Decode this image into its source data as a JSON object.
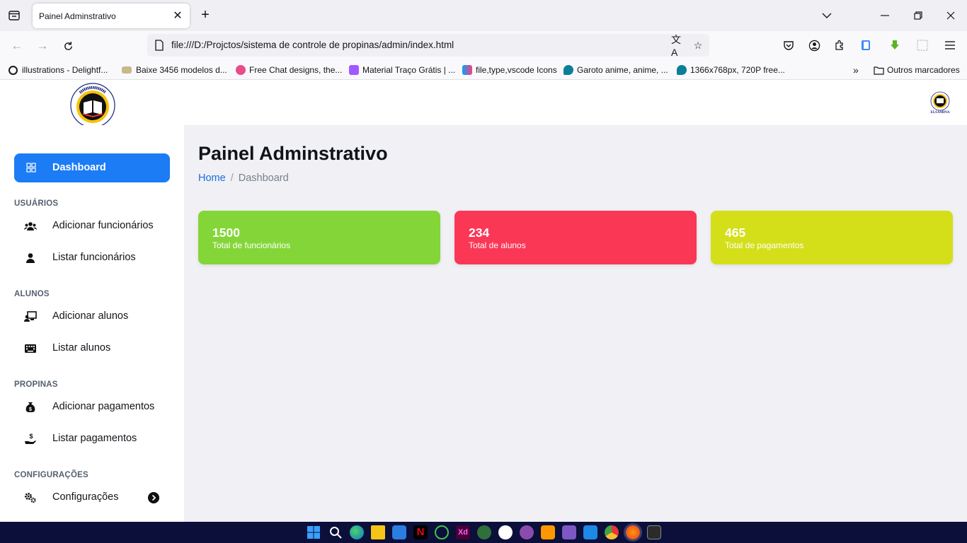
{
  "browser": {
    "tab_title": "Painel Adminstrativo",
    "new_tab": "+",
    "url": "file:///D:/Projctos/sistema de controle de propinas/admin/index.html",
    "bookmarks": [
      {
        "label": "illustrations - Delightf...",
        "color": "#1a1a1a"
      },
      {
        "label": "Baixe 3456 modelos d...",
        "color": "#c8b88a"
      },
      {
        "label": "Free Chat designs, the...",
        "color": "#ea4c89"
      },
      {
        "label": "Material Traço Grátis | ...",
        "color": "#a259ff"
      },
      {
        "label": "file,type,vscode Icons",
        "color": "#00a3ff"
      },
      {
        "label": "Garoto anime, anime, ...",
        "color": "#0a7f9a"
      },
      {
        "label": "1366x768px, 720P free...",
        "color": "#0a7f9a"
      }
    ],
    "other_bookmarks": "Outros marcadores"
  },
  "header": {
    "logo_alt": "ELSAMINA",
    "logo_ring_text": "INSTITUTO POLITÉCNICO PRIVADO"
  },
  "sidebar": {
    "active_item": "Dashboard",
    "sections": [
      {
        "heading": "USUÁRIOS",
        "items": [
          "Adicionar funcionários",
          "Listar funcionários"
        ]
      },
      {
        "heading": "ALUNOS",
        "items": [
          "Adicionar alunos",
          "Listar alunos"
        ]
      },
      {
        "heading": "PROPINAS",
        "items": [
          "Adicionar pagamentos",
          "Listar pagamentos"
        ]
      },
      {
        "heading": "CONFIGURAÇÕES",
        "items": [
          "Configurações"
        ]
      }
    ]
  },
  "main": {
    "title": "Painel Adminstrativo",
    "breadcrumb": {
      "home": "Home",
      "separator": "/",
      "current": "Dashboard"
    },
    "cards": [
      {
        "value": "1500",
        "label": "Total de funcionários",
        "color": "#84d638"
      },
      {
        "value": "234",
        "label": "Total de alunos",
        "color": "#fb3756"
      },
      {
        "value": "465",
        "label": "Total de pagamentos",
        "color": "#d4df1a"
      }
    ]
  },
  "colors": {
    "accent": "#1c7cf5",
    "taskbar": "#0b0f3a"
  }
}
